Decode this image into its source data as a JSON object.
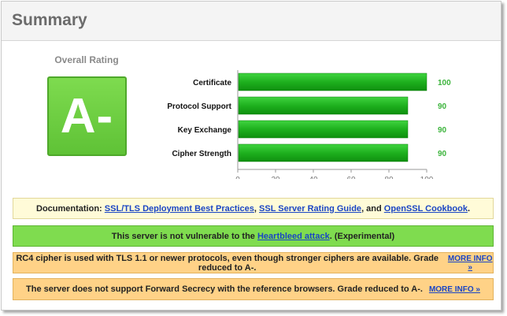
{
  "header": {
    "title": "Summary"
  },
  "rating": {
    "label": "Overall Rating",
    "grade": "A-"
  },
  "chart_data": {
    "type": "bar",
    "orientation": "horizontal",
    "categories": [
      "Certificate",
      "Protocol Support",
      "Key Exchange",
      "Cipher Strength"
    ],
    "values": [
      100,
      90,
      90,
      90
    ],
    "value_labels": [
      "100",
      "90",
      "90",
      "90"
    ],
    "xlim": [
      0,
      100
    ],
    "xticks": [
      "0",
      "20",
      "40",
      "60",
      "80",
      "100"
    ],
    "bar_color": "#1eb01e",
    "value_color": "#3cb43c",
    "grid": false
  },
  "messages": {
    "doc": {
      "prefix": "Documentation: ",
      "link1": "SSL/TLS Deployment Best Practices",
      "sep1": ", ",
      "link2": "SSL Server Rating Guide",
      "sep2": ", and ",
      "link3": "OpenSSL Cookbook",
      "suffix": "."
    },
    "heartbleed": {
      "prefix": "This server is not vulnerable to the ",
      "link": "Heartbleed attack",
      "suffix": ". (Experimental)"
    },
    "rc4": {
      "text": "RC4 cipher is used with TLS 1.1 or newer protocols, even though stronger ciphers are available. Grade reduced to A-.",
      "more": "MORE INFO »"
    },
    "fs": {
      "text": "The server does not support Forward Secrecy with the reference browsers. Grade reduced to A-.",
      "more": "MORE INFO »"
    }
  }
}
